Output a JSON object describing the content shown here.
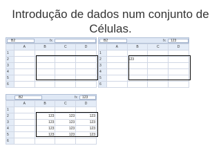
{
  "title_line1": "Introdução de dados num conjunto de",
  "title_line2": "Células.",
  "sheets": {
    "top_left": {
      "name_box": "B2",
      "formula": "",
      "fx_icon": "fx-icon",
      "columns": [
        "A",
        "B",
        "C",
        "D"
      ],
      "rows": [
        "1",
        "2",
        "3",
        "4",
        "5",
        "6"
      ]
    },
    "top_right": {
      "name_box": "B2",
      "formula": "123",
      "fx_icon": "fx-icon",
      "columns": [
        "A",
        "B",
        "C",
        "D"
      ],
      "rows": [
        "1",
        "2",
        "3",
        "4",
        "5",
        "6"
      ],
      "b2_value": "123"
    },
    "bottom": {
      "name_box": "B2",
      "formula": "123",
      "fx_icon": "fx-icon",
      "columns": [
        "A",
        "B",
        "C",
        "D"
      ],
      "rows": [
        "1",
        "2",
        "3",
        "4",
        "5",
        "6"
      ],
      "cell_value": "123"
    }
  },
  "colors": {
    "title": "#333333",
    "header_bg": "#e4ecf7",
    "gridline": "#d0d7e5",
    "selection": "#000000"
  }
}
